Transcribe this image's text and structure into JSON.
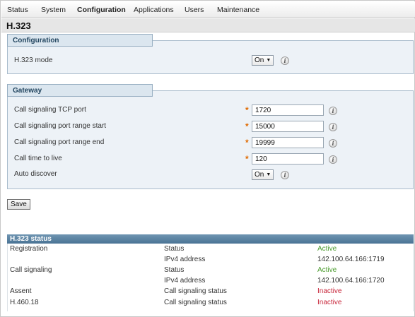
{
  "menu": {
    "items": [
      "Status",
      "System",
      "Configuration",
      "Applications",
      "Users",
      "Maintenance"
    ],
    "active": "Configuration"
  },
  "page": {
    "title": "H.323"
  },
  "configuration": {
    "legend": "Configuration",
    "mode_label": "H.323 mode",
    "mode_value": "On"
  },
  "gateway": {
    "legend": "Gateway",
    "fields": [
      {
        "label": "Call signaling TCP port",
        "value": "1720",
        "required": true
      },
      {
        "label": "Call signaling port range start",
        "value": "15000",
        "required": true
      },
      {
        "label": "Call signaling port range end",
        "value": "19999",
        "required": true
      },
      {
        "label": "Call time to live",
        "value": "120",
        "required": true
      }
    ],
    "auto_discover_label": "Auto discover",
    "auto_discover_value": "On",
    "required_marker": "*",
    "info_glyph": "i"
  },
  "save_label": "Save",
  "status": {
    "title": "H.323 status",
    "rows": [
      {
        "group": "Registration",
        "key": "Status",
        "value": "Active",
        "state": "active"
      },
      {
        "group": "",
        "key": "IPv4 address",
        "value": "142.100.64.166:1719",
        "state": ""
      },
      {
        "group": "Call signaling",
        "key": "Status",
        "value": "Active",
        "state": "active"
      },
      {
        "group": "",
        "key": "IPv4 address",
        "value": "142.100.64.166:1720",
        "state": ""
      },
      {
        "group": "Assent",
        "key": "Call signaling status",
        "value": "Inactive",
        "state": "inactive"
      },
      {
        "group": "H.460.18",
        "key": "Call signaling status",
        "value": "Inactive",
        "state": "inactive"
      }
    ]
  },
  "colors": {
    "active": "#4a9b2d",
    "inactive": "#c8283c",
    "required": "#e06a00",
    "status_header": "#4a7394"
  },
  "icons": {
    "info": "info-icon",
    "dropdown": "chevron-down-icon"
  }
}
